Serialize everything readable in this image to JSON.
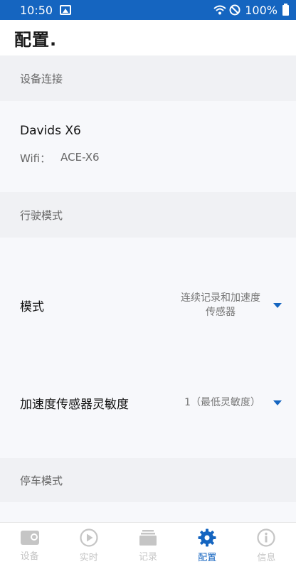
{
  "status_bar": {
    "time": "10:50",
    "battery": "100%"
  },
  "header": {
    "title": "配置."
  },
  "sections": {
    "device": {
      "title": "设备连接",
      "device_name": "Davids X6",
      "wifi_label": "Wifi：",
      "wifi_value": "ACE-X6"
    },
    "driving": {
      "title": "行驶模式",
      "mode_label": "模式",
      "mode_value_line1": "连续记录和加速度",
      "mode_value_line2": "传感器",
      "sensitivity_label": "加速度传感器灵敏度",
      "sensitivity_value": "1（最低灵敏度）"
    },
    "parking": {
      "title": "停车模式"
    }
  },
  "nav": [
    {
      "label": "设备",
      "icon": "device-icon"
    },
    {
      "label": "实时",
      "icon": "play-icon"
    },
    {
      "label": "记录",
      "icon": "records-icon"
    },
    {
      "label": "配置",
      "icon": "gear-icon",
      "active": true
    },
    {
      "label": "信息",
      "icon": "info-icon"
    }
  ],
  "colors": {
    "accent": "#1565c0",
    "inactive": "#c5c5c5"
  }
}
